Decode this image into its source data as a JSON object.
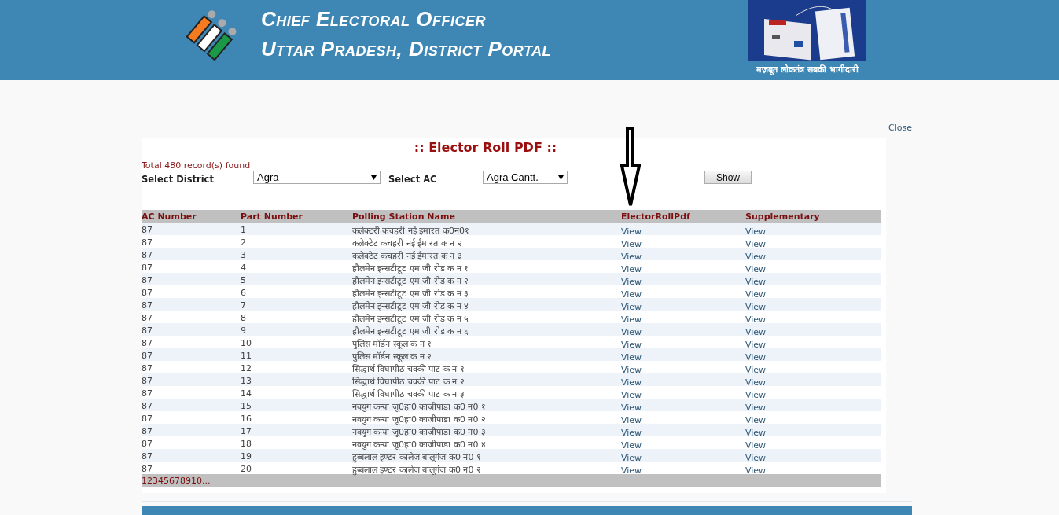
{
  "header": {
    "title_lines": [
      "Chief Electoral Officer",
      "Uttar Pradesh, District Portal"
    ],
    "banner_caption": "मज़बूत लोकतंत्र सबकी भागीदारी"
  },
  "close_link": "Close",
  "panel": {
    "title": ":: Elector Roll PDF ::",
    "record_count": "Total 480 record(s) found",
    "filters": [
      {
        "label": "Select District",
        "value": "Agra"
      },
      {
        "label": "Select AC",
        "value": "Agra Cantt."
      }
    ],
    "show_button": "Show"
  },
  "table": {
    "columns": [
      "AC Number",
      "Part Number",
      "Polling Station Name",
      "ElectorRollPdf",
      "Supplementary"
    ],
    "rows": [
      {
        "ac": "87",
        "part": "1",
        "station": "कलेक्टरी कचहरी नई इमारत क0न0१",
        "roll": "View",
        "supplementary": "View"
      },
      {
        "ac": "87",
        "part": "2",
        "station": "कलेक्टेट कचहरी नई ईमारत क न २",
        "roll": "View",
        "supplementary": "View"
      },
      {
        "ac": "87",
        "part": "3",
        "station": "कलेक्टेट कचहरी नई ईमारत क न ३",
        "roll": "View",
        "supplementary": "View"
      },
      {
        "ac": "87",
        "part": "4",
        "station": "हौलमेन इन्सटीटूट एम जी रोड क न १",
        "roll": "View",
        "supplementary": "View"
      },
      {
        "ac": "87",
        "part": "5",
        "station": "हौलमेन इन्सटीटूट एम जी रोड क न २",
        "roll": "View",
        "supplementary": "View"
      },
      {
        "ac": "87",
        "part": "6",
        "station": "हौलमेन इन्सटीटूट एम जी रोड क न ३",
        "roll": "View",
        "supplementary": "View"
      },
      {
        "ac": "87",
        "part": "7",
        "station": "हौलमेन इन्सटीटूट एम जी रोड क न ४",
        "roll": "View",
        "supplementary": "View"
      },
      {
        "ac": "87",
        "part": "8",
        "station": "हौलमेन इन्सटीटूट एम जी रोड क न ५",
        "roll": "View",
        "supplementary": "View"
      },
      {
        "ac": "87",
        "part": "9",
        "station": "हौलमेन इन्सटीटूट एम जी रोड क न ६",
        "roll": "View",
        "supplementary": "View"
      },
      {
        "ac": "87",
        "part": "10",
        "station": "पुलिस मॉर्डन स्कूल क न १",
        "roll": "View",
        "supplementary": "View"
      },
      {
        "ac": "87",
        "part": "11",
        "station": "पुलिस मॉर्डन स्कूल क न २",
        "roll": "View",
        "supplementary": "View"
      },
      {
        "ac": "87",
        "part": "12",
        "station": "सिद्धार्थ विघापीठ चक्की पाट क न १",
        "roll": "View",
        "supplementary": "View"
      },
      {
        "ac": "87",
        "part": "13",
        "station": "सिद्धार्थ विघापीठ चक्की पाट क न २",
        "roll": "View",
        "supplementary": "View"
      },
      {
        "ac": "87",
        "part": "14",
        "station": "सिद्धार्थ विघापीठ चक्की पाट क न ३",
        "roll": "View",
        "supplementary": "View"
      },
      {
        "ac": "87",
        "part": "15",
        "station": "नवयुग कन्या जू0हा0 काजीपाडा क0 न0 १",
        "roll": "View",
        "supplementary": "View"
      },
      {
        "ac": "87",
        "part": "16",
        "station": "नवयुग कन्या जू0हा0 काजीपाडा क0 न0 २",
        "roll": "View",
        "supplementary": "View"
      },
      {
        "ac": "87",
        "part": "17",
        "station": "नवयुग कन्या जू0हा0 काजीपाडा क0 न0 ३",
        "roll": "View",
        "supplementary": "View"
      },
      {
        "ac": "87",
        "part": "18",
        "station": "नवयुग कन्या जू0हा0 काजीपाडा क0 न0 ४",
        "roll": "View",
        "supplementary": "View"
      },
      {
        "ac": "87",
        "part": "19",
        "station": "हुब्बलाल इण्टर कालेज बालूगंज क0 न0 १",
        "roll": "View",
        "supplementary": "View"
      },
      {
        "ac": "87",
        "part": "20",
        "station": "हुब्बलाल इण्टर कालेज बालूगंज क0 न0 २",
        "roll": "View",
        "supplementary": "View"
      }
    ],
    "pagination": "12345678910..."
  }
}
